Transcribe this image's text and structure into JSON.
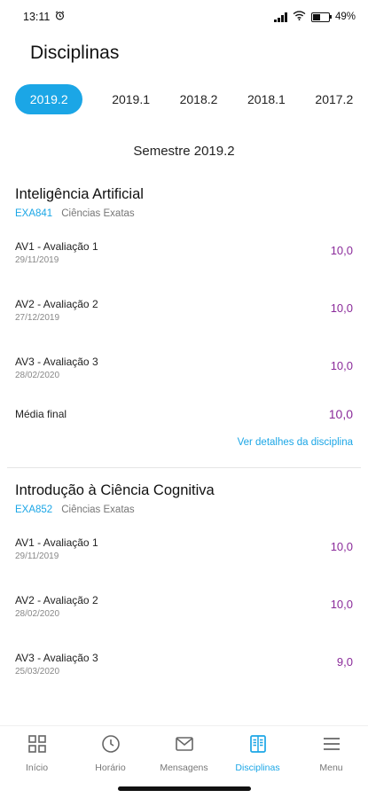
{
  "status": {
    "time": "13:11",
    "battery": "49%"
  },
  "title": "Disciplinas",
  "tabs": [
    "2019.2",
    "2019.1",
    "2018.2",
    "2018.1",
    "2017.2"
  ],
  "semester_label": "Semestre 2019.2",
  "courses": [
    {
      "name": "Inteligência Artificial",
      "code": "EXA841",
      "area": "Ciências Exatas",
      "grades": [
        {
          "name": "AV1 - Avaliação 1",
          "date": "29/11/2019",
          "value": "10,0"
        },
        {
          "name": "AV2 - Avaliação 2",
          "date": "27/12/2019",
          "value": "10,0"
        },
        {
          "name": "AV3 - Avaliação 3",
          "date": "28/02/2020",
          "value": "10,0"
        }
      ],
      "final_label": "Média final",
      "final_value": "10,0",
      "details_link": "Ver detalhes da disciplina"
    },
    {
      "name": "Introdução à Ciência Cognitiva",
      "code": "EXA852",
      "area": "Ciências Exatas",
      "grades": [
        {
          "name": "AV1 - Avaliação 1",
          "date": "29/11/2019",
          "value": "10,0"
        },
        {
          "name": "AV2 - Avaliação 2",
          "date": "28/02/2020",
          "value": "10,0"
        },
        {
          "name": "AV3 - Avaliação 3",
          "date": "25/03/2020",
          "value": "9,0"
        }
      ]
    }
  ],
  "nav": [
    {
      "label": "Início",
      "icon": "grid-icon"
    },
    {
      "label": "Horário",
      "icon": "clock-icon"
    },
    {
      "label": "Mensagens",
      "icon": "envelope-icon"
    },
    {
      "label": "Disciplinas",
      "icon": "book-icon",
      "active": true
    },
    {
      "label": "Menu",
      "icon": "hamburger-icon"
    }
  ],
  "colors": {
    "accent": "#1ba6e6",
    "grade": "#8a2a9a"
  }
}
